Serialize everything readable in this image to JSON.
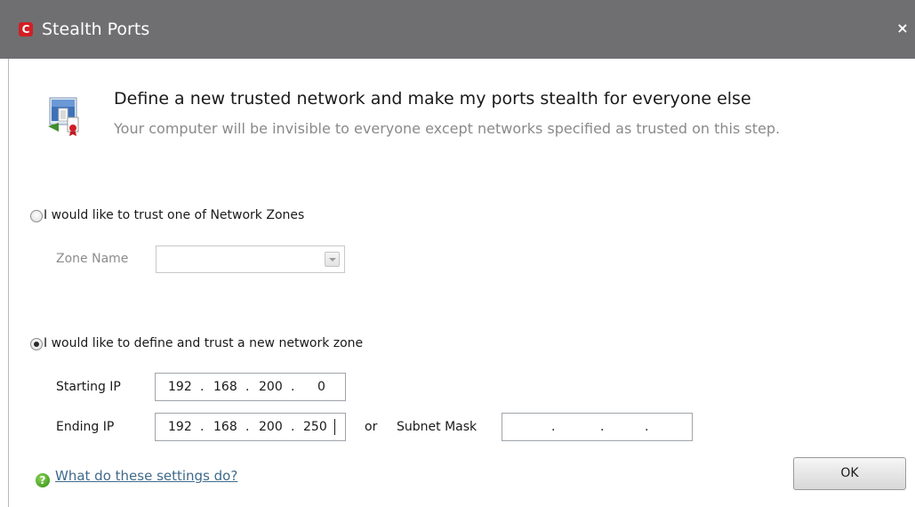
{
  "window": {
    "title": "Stealth Ports",
    "app_icon_glyph": "C",
    "close_glyph": "×"
  },
  "header": {
    "icon": "network-shield-icon",
    "title": "Define a new trusted network and make my ports stealth for everyone else",
    "subtitle": "Your computer will be invisible to everyone except networks specified as trusted on this step."
  },
  "option_zone": {
    "label": "I would like to trust one of Network Zones",
    "selected": false,
    "zone_name_label": "Zone Name",
    "zone_name_value": ""
  },
  "option_new_zone": {
    "label": "I would like to define and trust a new network zone",
    "selected": true,
    "starting_ip_label": "Starting IP",
    "starting_ip": [
      "192",
      "168",
      "200",
      "0"
    ],
    "ending_ip_label": "Ending IP",
    "ending_ip": [
      "192",
      "168",
      "200",
      "250"
    ],
    "or_label": "or",
    "subnet_mask_label": "Subnet Mask",
    "subnet_mask": [
      "",
      "",
      "",
      ""
    ],
    "ip_separator": "."
  },
  "footer": {
    "help_icon_glyph": "?",
    "help_link": "What do these settings do?",
    "ok_label": "OK"
  },
  "colors": {
    "titlebar": "#6f6f71",
    "app_icon": "#d11f26",
    "link": "#3f6a8a",
    "help_icon": "#3d9b1c"
  }
}
